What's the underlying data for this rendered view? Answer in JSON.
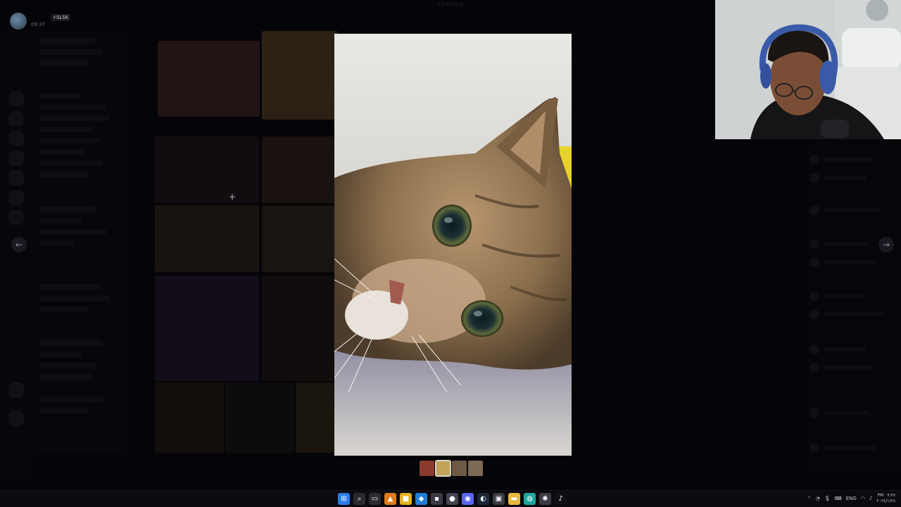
{
  "window": {
    "title": "Untitled"
  },
  "user": {
    "time": "09:37",
    "status_tag": "⚡SLSK"
  },
  "viewer": {
    "prev_arrow": "←",
    "next_arrow": "→",
    "crosshair": "+",
    "thumbnails": [
      {
        "name": "thumb-1",
        "color": "#8a3b2c"
      },
      {
        "name": "thumb-2",
        "color": "#c2a35a"
      },
      {
        "name": "thumb-3",
        "color": "#6e5a44"
      },
      {
        "name": "thumb-4",
        "color": "#7d6a55"
      }
    ],
    "active_thumbnail": 2
  },
  "taskbar": {
    "apps": [
      {
        "icon": "windows-start-icon",
        "glyph": "⊞",
        "color": "#2b7de9"
      },
      {
        "icon": "search-icon",
        "glyph": "⌕",
        "color": "#2a2a30"
      },
      {
        "icon": "task-view-icon",
        "glyph": "▭",
        "color": "#2a2a30"
      },
      {
        "icon": "vlc-icon",
        "glyph": "▲",
        "color": "#e07a1a"
      },
      {
        "icon": "app-yellow-icon",
        "glyph": "■",
        "color": "#e6b020"
      },
      {
        "icon": "vscode-icon",
        "glyph": "◆",
        "color": "#1e7fd6"
      },
      {
        "icon": "terminal-icon",
        "glyph": "▪",
        "color": "#3a3a44"
      },
      {
        "icon": "obs-icon",
        "glyph": "●",
        "color": "#444450"
      },
      {
        "icon": "discord-icon",
        "glyph": "◉",
        "color": "#5865f2"
      },
      {
        "icon": "steam-icon",
        "glyph": "◐",
        "color": "#1b2838"
      },
      {
        "icon": "store-icon",
        "glyph": "▣",
        "color": "#3a3a44"
      },
      {
        "icon": "explorer-icon",
        "glyph": "▬",
        "color": "#e8b83a"
      },
      {
        "icon": "edge-icon",
        "glyph": "◍",
        "color": "#1fa6a0"
      },
      {
        "icon": "settings-icon",
        "glyph": "✺",
        "color": "#3a3a44"
      },
      {
        "icon": "tiktok-icon",
        "glyph": "♪",
        "color": "#111114"
      }
    ],
    "language": "ENG",
    "clock_time": "PM ٠٩:٣٧",
    "clock_date": "٢٠٢٤/١/٢٨"
  }
}
